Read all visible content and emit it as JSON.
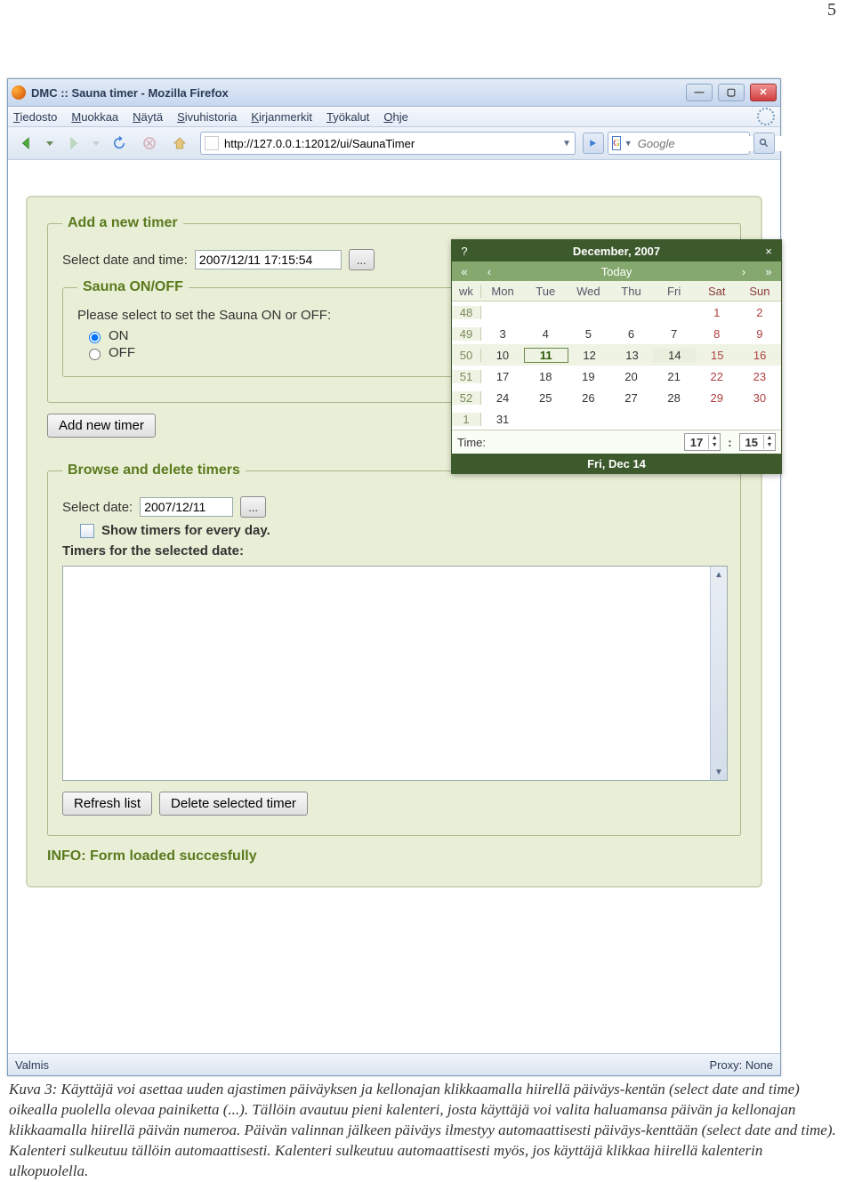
{
  "page_number": "5",
  "window": {
    "title": "DMC :: Sauna timer - Mozilla Firefox",
    "menu": [
      "Tiedosto",
      "Muokkaa",
      "Näytä",
      "Sivuhistoria",
      "Kirjanmerkit",
      "Työkalut",
      "Ohje"
    ],
    "url": "http://127.0.0.1:12012/ui/SaunaTimer",
    "search_placeholder": "Google",
    "status_left": "Valmis",
    "status_right": "Proxy: None"
  },
  "form": {
    "fs_add_legend": "Add a new timer",
    "select_dt_label": "Select date and time:",
    "select_dt_value": "2007/12/11 17:15:54",
    "picker_btn": "...",
    "fs_onoff_legend": "Sauna ON/OFF",
    "onoff_prompt": "Please select to set the Sauna ON or OFF:",
    "on_label": "ON",
    "off_label": "OFF",
    "add_btn": "Add new timer",
    "fs_browse_legend": "Browse and delete timers",
    "select_date_label": "Select date:",
    "select_date_value": "2007/12/11",
    "every_day_label": "Show timers for every day.",
    "list_label": "Timers for the selected date:",
    "refresh_btn": "Refresh list",
    "delete_btn": "Delete selected timer",
    "info": "INFO: Form loaded succesfully"
  },
  "cal": {
    "month": "December, 2007",
    "today_label": "Today",
    "wk_hdr": "wk",
    "dow": [
      "Mon",
      "Tue",
      "Wed",
      "Thu",
      "Fri",
      "Sat",
      "Sun"
    ],
    "rows": [
      {
        "wk": "48",
        "days": [
          "",
          "",
          "",
          "",
          "",
          "1",
          "2"
        ]
      },
      {
        "wk": "49",
        "days": [
          "3",
          "4",
          "5",
          "6",
          "7",
          "8",
          "9"
        ]
      },
      {
        "wk": "50",
        "days": [
          "10",
          "11",
          "12",
          "13",
          "14",
          "15",
          "16"
        ]
      },
      {
        "wk": "51",
        "days": [
          "17",
          "18",
          "19",
          "20",
          "21",
          "22",
          "23"
        ]
      },
      {
        "wk": "52",
        "days": [
          "24",
          "25",
          "26",
          "27",
          "28",
          "29",
          "30"
        ]
      },
      {
        "wk": "1",
        "days": [
          "31",
          "",
          "",
          "",
          "",
          "",
          ""
        ]
      }
    ],
    "time_label": "Time:",
    "hour": "17",
    "minute": "15",
    "footer": "Fri, Dec 14"
  },
  "caption": "Kuva 3: Käyttäjä voi asettaa uuden ajastimen päiväyksen ja kellonajan klikkaamalla hiirellä päiväys-kentän (select date and time) oikealla puolella olevaa painiketta (...). Tällöin avautuu pieni kalenteri, josta käyttäjä voi valita haluamansa päivän ja kellonajan klikkaamalla hiirellä päivän numeroa. Päivän valinnan jälkeen päiväys ilmestyy automaattisesti päiväys-kenttään (select date and time). Kalenteri sulkeutuu tällöin automaattisesti. Kalenteri sulkeutuu automaattisesti myös, jos käyttäjä klikkaa hiirellä kalenterin ulkopuolella."
}
